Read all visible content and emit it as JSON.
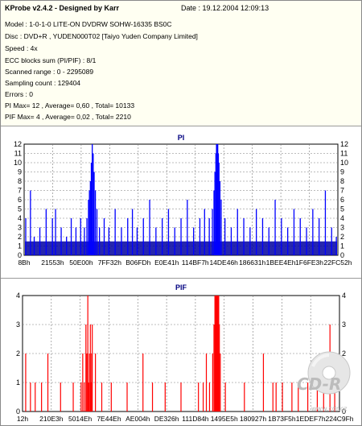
{
  "header": {
    "title": "KProbe v2.4.2 - Designed by Karr",
    "date": "Date : 19.12.2004 12:09:13"
  },
  "info_lines": [
    "Model : 1-0-1-0 LITE-ON DVDRW SOHW-16335 BS0C",
    "Disc : DVD+R , YUDEN000T02 [Taiyo Yuden Company Limited]",
    "Speed : 4x",
    "ECC blocks sum (PI/PIF) : 8/1",
    "Scanned range : 0 - 2295089",
    "Sampling count : 129404",
    "Errors : 0",
    "PI Max= 12 , Average= 0,60 , Total= 10133",
    "PIF Max= 4 , Average= 0,02 , Total= 2210"
  ],
  "watermark": {
    "logo": "CD-R",
    "url": "www.cdr.cz"
  },
  "colors": {
    "pi_bars": "#0000ff",
    "pif_bars": "#ff0000",
    "pi_baseline": "#0000a0",
    "pif_baseline": "#c00000",
    "plot_bg": "#ffffff",
    "info_bg": "#fffff2"
  },
  "chart_data": [
    {
      "type": "bar",
      "title": "PI",
      "ylim": [
        0,
        12
      ],
      "yticks": [
        0,
        1,
        2,
        3,
        4,
        5,
        6,
        7,
        8,
        9,
        10,
        11,
        12
      ],
      "xlim": [
        0,
        2295089
      ],
      "x_tick_labels": [
        "8Bh",
        "21553h",
        "50E00h",
        "7FF32h",
        "B06FDh",
        "E0E41h",
        "114BF7h",
        "14DE46h",
        "186631h",
        "1BEE4Eh",
        "1F6FE3h",
        "22FC52h"
      ],
      "grid": "dashed",
      "series": [
        {
          "values": [
            {
              "x": 0.005,
              "y": 4
            },
            {
              "x": 0.02,
              "y": 7
            },
            {
              "x": 0.032,
              "y": 2
            },
            {
              "x": 0.05,
              "y": 3
            },
            {
              "x": 0.07,
              "y": 5
            },
            {
              "x": 0.09,
              "y": 4
            },
            {
              "x": 0.1,
              "y": 5
            },
            {
              "x": 0.118,
              "y": 3
            },
            {
              "x": 0.135,
              "y": 2
            },
            {
              "x": 0.15,
              "y": 4
            },
            {
              "x": 0.165,
              "y": 3
            },
            {
              "x": 0.18,
              "y": 4
            },
            {
              "x": 0.192,
              "y": 3
            },
            {
              "x": 0.2,
              "y": 4
            },
            {
              "x": 0.205,
              "y": 6
            },
            {
              "x": 0.208,
              "y": 7
            },
            {
              "x": 0.211,
              "y": 8
            },
            {
              "x": 0.214,
              "y": 10
            },
            {
              "x": 0.217,
              "y": 12
            },
            {
              "x": 0.22,
              "y": 11
            },
            {
              "x": 0.223,
              "y": 9
            },
            {
              "x": 0.227,
              "y": 7
            },
            {
              "x": 0.232,
              "y": 5
            },
            {
              "x": 0.24,
              "y": 3
            },
            {
              "x": 0.255,
              "y": 4
            },
            {
              "x": 0.27,
              "y": 3
            },
            {
              "x": 0.29,
              "y": 5
            },
            {
              "x": 0.31,
              "y": 3
            },
            {
              "x": 0.33,
              "y": 4
            },
            {
              "x": 0.345,
              "y": 5
            },
            {
              "x": 0.36,
              "y": 3
            },
            {
              "x": 0.38,
              "y": 4
            },
            {
              "x": 0.4,
              "y": 6
            },
            {
              "x": 0.42,
              "y": 3
            },
            {
              "x": 0.44,
              "y": 4
            },
            {
              "x": 0.46,
              "y": 5
            },
            {
              "x": 0.48,
              "y": 3
            },
            {
              "x": 0.5,
              "y": 4
            },
            {
              "x": 0.52,
              "y": 6
            },
            {
              "x": 0.54,
              "y": 3
            },
            {
              "x": 0.56,
              "y": 4
            },
            {
              "x": 0.575,
              "y": 5
            },
            {
              "x": 0.59,
              "y": 4
            },
            {
              "x": 0.6,
              "y": 5
            },
            {
              "x": 0.605,
              "y": 7
            },
            {
              "x": 0.608,
              "y": 9
            },
            {
              "x": 0.611,
              "y": 11
            },
            {
              "x": 0.613,
              "y": 12
            },
            {
              "x": 0.615,
              "y": 12
            },
            {
              "x": 0.617,
              "y": 12
            },
            {
              "x": 0.619,
              "y": 11
            },
            {
              "x": 0.621,
              "y": 10
            },
            {
              "x": 0.624,
              "y": 8
            },
            {
              "x": 0.628,
              "y": 6
            },
            {
              "x": 0.64,
              "y": 4
            },
            {
              "x": 0.66,
              "y": 3
            },
            {
              "x": 0.68,
              "y": 5
            },
            {
              "x": 0.7,
              "y": 4
            },
            {
              "x": 0.72,
              "y": 3
            },
            {
              "x": 0.74,
              "y": 5
            },
            {
              "x": 0.76,
              "y": 4
            },
            {
              "x": 0.78,
              "y": 3
            },
            {
              "x": 0.8,
              "y": 6
            },
            {
              "x": 0.82,
              "y": 4
            },
            {
              "x": 0.84,
              "y": 3
            },
            {
              "x": 0.86,
              "y": 5
            },
            {
              "x": 0.88,
              "y": 4
            },
            {
              "x": 0.9,
              "y": 3
            },
            {
              "x": 0.92,
              "y": 5
            },
            {
              "x": 0.94,
              "y": 4
            },
            {
              "x": 0.96,
              "y": 7
            },
            {
              "x": 0.98,
              "y": 3
            },
            {
              "x": 0.995,
              "y": 2
            }
          ]
        }
      ]
    },
    {
      "type": "bar",
      "title": "PIF",
      "ylim": [
        0,
        4
      ],
      "yticks": [
        0,
        1,
        2,
        3,
        4
      ],
      "xlim": [
        0,
        2295089
      ],
      "x_tick_labels": [
        "12h",
        "210E3h",
        "5014Eh",
        "7E44Eh",
        "AE004h",
        "DE326h",
        "111D84h",
        "1495E5h",
        "180927h",
        "1B73F5h",
        "1EDEF7h",
        "224C9Fh"
      ],
      "grid": "dashed",
      "series": [
        {
          "values": [
            {
              "x": 0.01,
              "y": 2
            },
            {
              "x": 0.025,
              "y": 1
            },
            {
              "x": 0.04,
              "y": 1
            },
            {
              "x": 0.06,
              "y": 1
            },
            {
              "x": 0.08,
              "y": 2
            },
            {
              "x": 0.12,
              "y": 1
            },
            {
              "x": 0.16,
              "y": 1
            },
            {
              "x": 0.185,
              "y": 1
            },
            {
              "x": 0.19,
              "y": 2
            },
            {
              "x": 0.195,
              "y": 1
            },
            {
              "x": 0.2,
              "y": 3
            },
            {
              "x": 0.203,
              "y": 2
            },
            {
              "x": 0.206,
              "y": 4
            },
            {
              "x": 0.208,
              "y": 1
            },
            {
              "x": 0.211,
              "y": 2
            },
            {
              "x": 0.214,
              "y": 3
            },
            {
              "x": 0.216,
              "y": 1
            },
            {
              "x": 0.218,
              "y": 2
            },
            {
              "x": 0.22,
              "y": 3
            },
            {
              "x": 0.23,
              "y": 2
            },
            {
              "x": 0.25,
              "y": 1
            },
            {
              "x": 0.28,
              "y": 1
            },
            {
              "x": 0.33,
              "y": 1
            },
            {
              "x": 0.38,
              "y": 2
            },
            {
              "x": 0.41,
              "y": 1
            },
            {
              "x": 0.45,
              "y": 1
            },
            {
              "x": 0.5,
              "y": 1
            },
            {
              "x": 0.555,
              "y": 1
            },
            {
              "x": 0.57,
              "y": 1
            },
            {
              "x": 0.58,
              "y": 2
            },
            {
              "x": 0.59,
              "y": 1
            },
            {
              "x": 0.6,
              "y": 2
            },
            {
              "x": 0.604,
              "y": 3
            },
            {
              "x": 0.607,
              "y": 4
            },
            {
              "x": 0.609,
              "y": 4
            },
            {
              "x": 0.611,
              "y": 4
            },
            {
              "x": 0.613,
              "y": 4
            },
            {
              "x": 0.615,
              "y": 4
            },
            {
              "x": 0.617,
              "y": 4
            },
            {
              "x": 0.619,
              "y": 4
            },
            {
              "x": 0.621,
              "y": 3
            },
            {
              "x": 0.624,
              "y": 2
            },
            {
              "x": 0.64,
              "y": 1
            },
            {
              "x": 0.7,
              "y": 1
            },
            {
              "x": 0.76,
              "y": 2
            },
            {
              "x": 0.79,
              "y": 1
            },
            {
              "x": 0.8,
              "y": 1
            },
            {
              "x": 0.82,
              "y": 1
            },
            {
              "x": 0.85,
              "y": 1
            },
            {
              "x": 0.87,
              "y": 1
            },
            {
              "x": 0.9,
              "y": 1
            },
            {
              "x": 0.93,
              "y": 1
            },
            {
              "x": 0.95,
              "y": 2
            },
            {
              "x": 0.97,
              "y": 3
            },
            {
              "x": 0.985,
              "y": 1
            }
          ]
        }
      ]
    }
  ]
}
